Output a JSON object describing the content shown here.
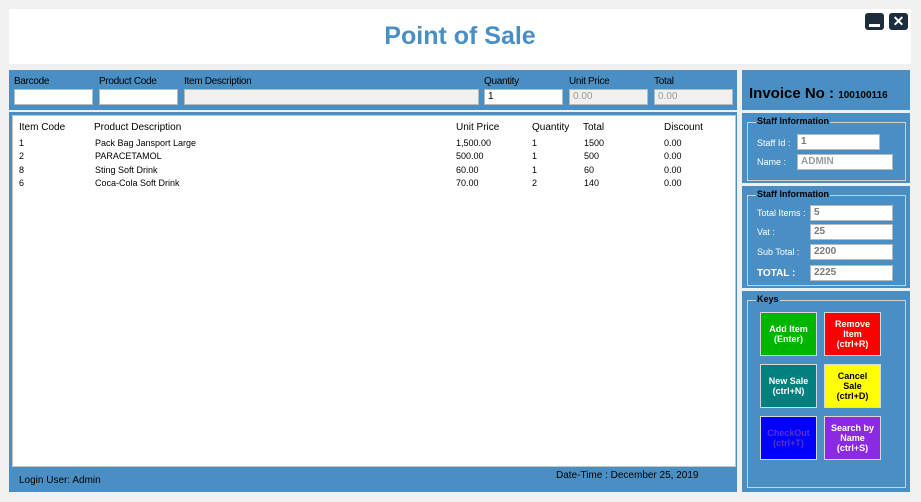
{
  "header": {
    "title": "Point of Sale"
  },
  "entry": {
    "barcode_label": "Barcode",
    "product_code_label": "Product Code",
    "item_description_label": "Item Description",
    "quantity_label": "Quantity",
    "unit_price_label": "Unit Price",
    "total_label": "Total",
    "quantity_value": "1",
    "unit_price_value": "0.00",
    "total_value": "0.00"
  },
  "table": {
    "headers": [
      "Item Code",
      "Product Description",
      "Unit Price",
      "Quantity",
      "Total",
      "Discount"
    ],
    "rows": [
      [
        "1",
        "Pack Bag Jansport Large",
        "1,500.00",
        "1",
        "1500",
        "0.00"
      ],
      [
        "2",
        "PARACETAMOL",
        "500.00",
        "1",
        "500",
        "0.00"
      ],
      [
        "8",
        "Sting Soft Drink",
        "60.00",
        "1",
        "60",
        "0.00"
      ],
      [
        "6",
        "Coca-Cola Soft Drink",
        "70.00",
        "2",
        "140",
        "0.00"
      ]
    ]
  },
  "footer": {
    "login_user": "Login User: Admin",
    "datetime": "Date-Time : December 25, 2019"
  },
  "invoice": {
    "label": "Invoice No :",
    "number": "100100116"
  },
  "staff": {
    "title": "Staff Information",
    "staff_id_label": "Staff Id :",
    "staff_id_value": "1",
    "name_label": "Name :",
    "name_value": "ADMIN"
  },
  "totals": {
    "title": "Staff Information",
    "total_items_label": "Total Items :",
    "total_items_value": "5",
    "vat_label": "Vat :",
    "vat_value": "25",
    "subtotal_label": "Sub Total :",
    "subtotal_value": "2200",
    "total_label": "TOTAL :",
    "total_value": "2225"
  },
  "keys": {
    "title": "Keys",
    "add_item": "Add Item\n(Enter)",
    "remove_item": "Remove\nItem\n(ctrl+R)",
    "new_sale": "New Sale\n(ctrl+N)",
    "cancel_sale": "Cancel\nSale\n(ctrl+D)",
    "checkout": "CheckOut\n(ctrl+T)",
    "search_by_name": "Search by\nName\n(ctrl+S)"
  },
  "colors": {
    "accent": "#4a8fc4",
    "add_item": "#00b400",
    "remove_item": "#ff0000",
    "new_sale": "#007f7f",
    "cancel_sale": "#ffff00",
    "checkout": "#0000ff",
    "search_by_name": "#8a2be2"
  }
}
